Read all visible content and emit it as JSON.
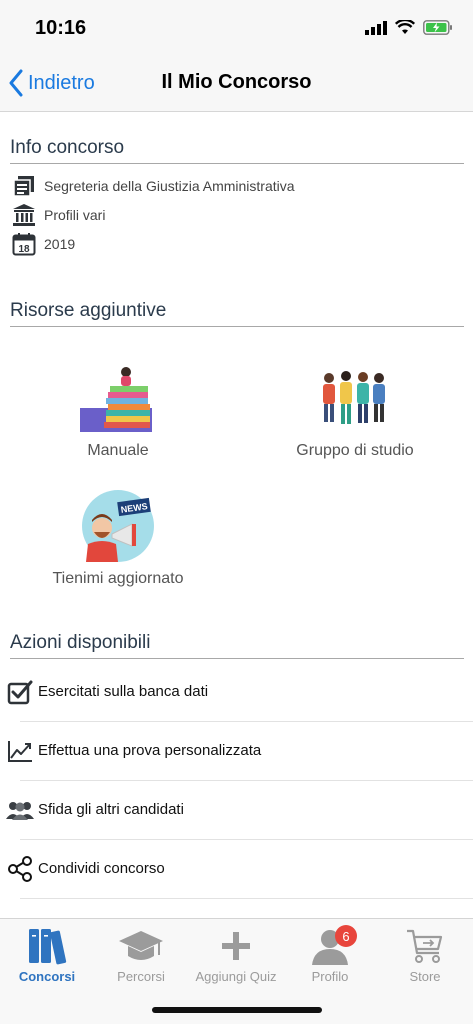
{
  "status_bar": {
    "time": "10:16"
  },
  "nav": {
    "back_label": "Indietro",
    "title": "Il Mio Concorso"
  },
  "info": {
    "header": "Info concorso",
    "rows": [
      {
        "icon": "document-icon",
        "text": "Segreteria della Giustizia Amministrativa"
      },
      {
        "icon": "institution-icon",
        "text": "Profili vari"
      },
      {
        "icon": "calendar-icon",
        "text": "2019"
      }
    ],
    "calendar_day": "18"
  },
  "resources": {
    "header": "Risorse aggiuntive",
    "items": [
      {
        "icon": "books-icon",
        "label": "Manuale"
      },
      {
        "icon": "group-icon",
        "label": "Gruppo di studio"
      },
      {
        "icon": "news-megaphone-icon",
        "label": "Tienimi aggiornato",
        "badge_text": "NEWS"
      }
    ]
  },
  "actions": {
    "header": "Azioni disponibili",
    "items": [
      {
        "icon": "checkbox-icon",
        "label": "Esercitati sulla banca dati"
      },
      {
        "icon": "trend-chart-icon",
        "label": "Effettua una prova personalizzata"
      },
      {
        "icon": "users-icon",
        "label": "Sfida gli altri candidati"
      },
      {
        "icon": "share-icon",
        "label": "Condividi concorso"
      }
    ]
  },
  "tabs": [
    {
      "icon": "books-tab-icon",
      "label": "Concorsi",
      "active": true
    },
    {
      "icon": "graduation-cap-icon",
      "label": "Percorsi",
      "active": false
    },
    {
      "icon": "plus-icon",
      "label": "Aggiungi Quiz",
      "active": false
    },
    {
      "icon": "profile-icon",
      "label": "Profilo",
      "active": false,
      "badge": "6"
    },
    {
      "icon": "cart-icon",
      "label": "Store",
      "active": false
    }
  ],
  "colors": {
    "accent": "#1a7ae0",
    "tab_active": "#2f74c0",
    "badge": "#e8453c"
  }
}
